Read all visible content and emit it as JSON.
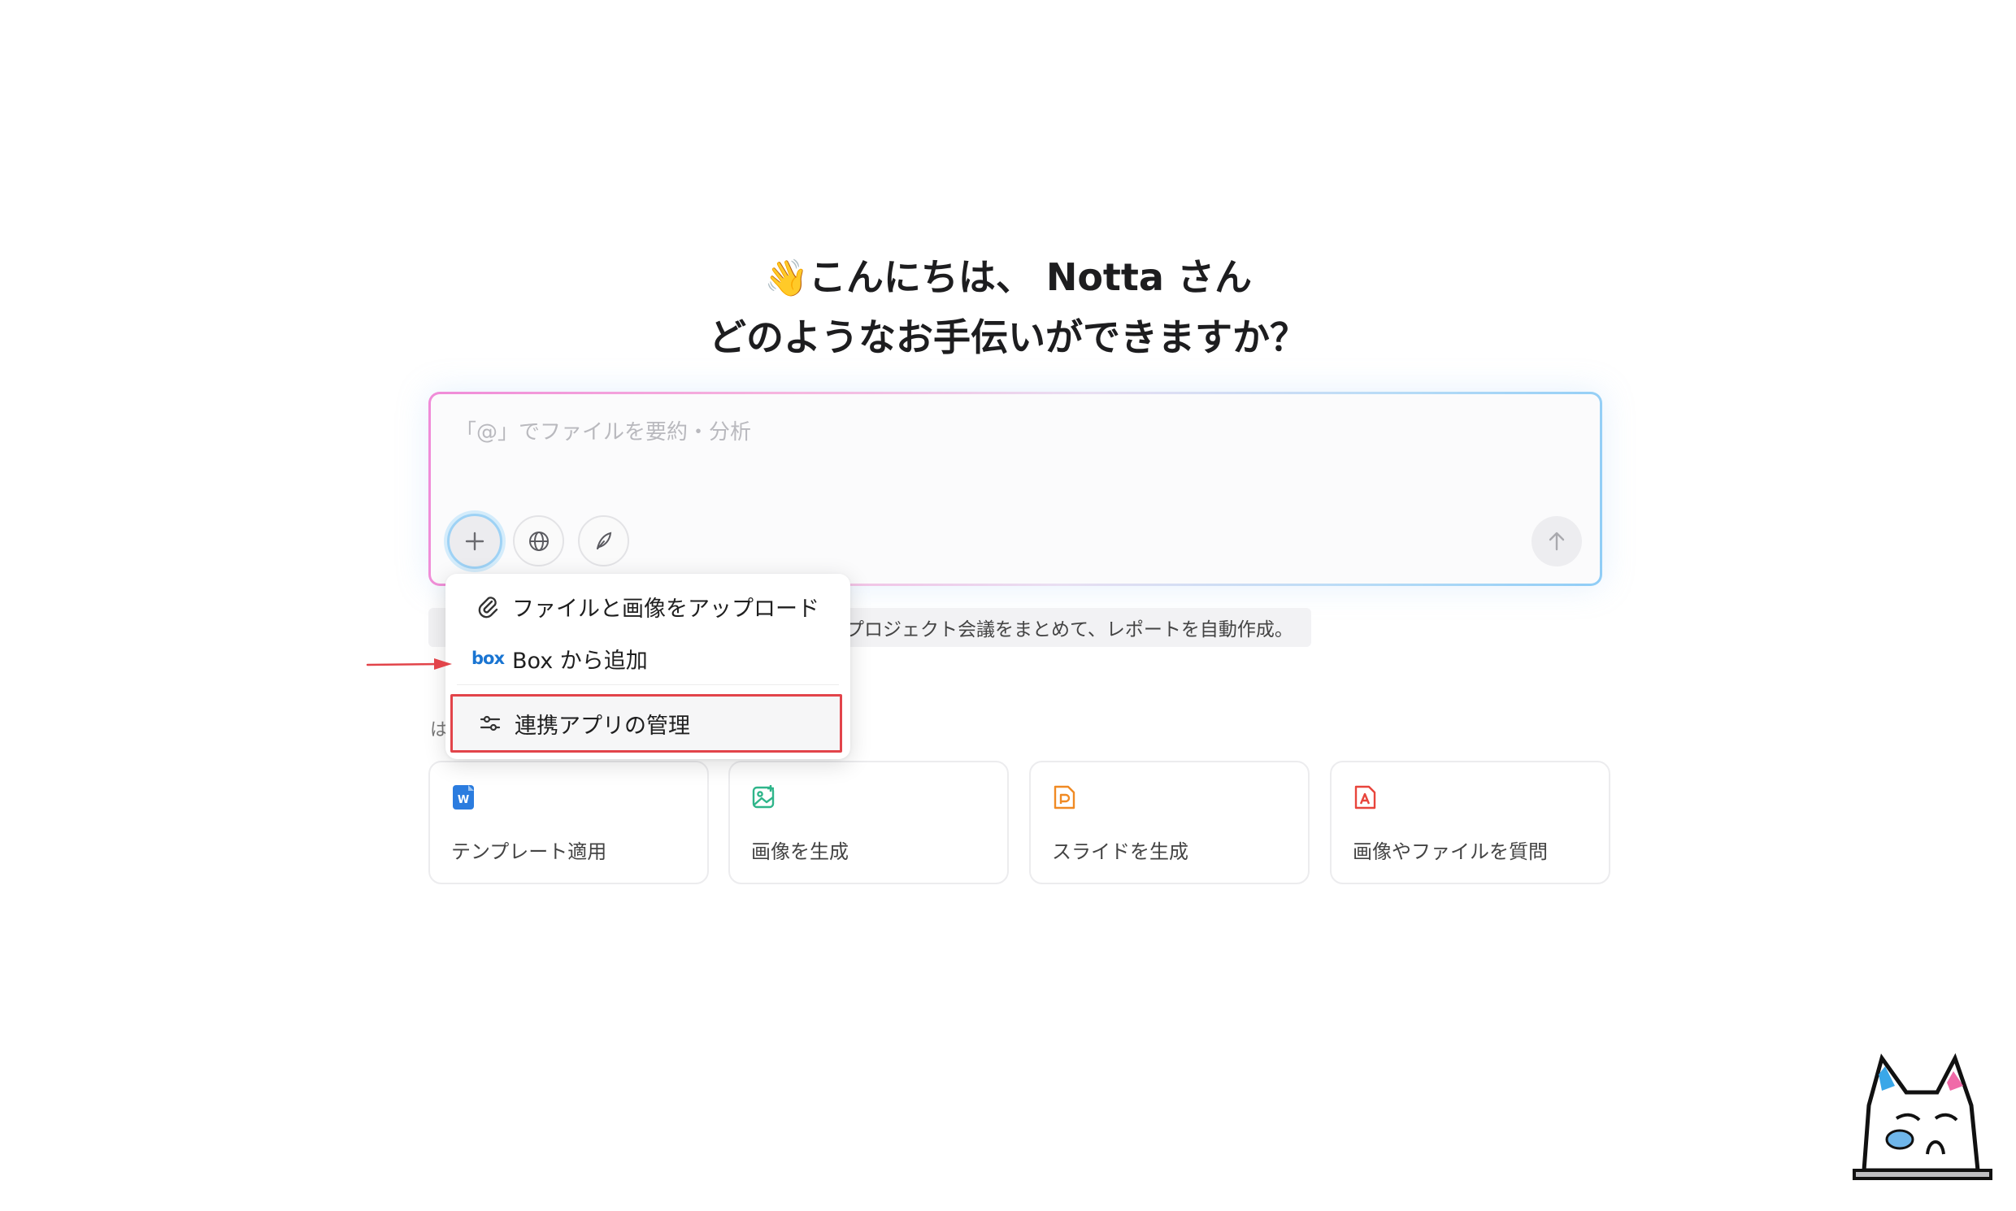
{
  "greeting": {
    "wave_emoji": "👋",
    "line1": "こんにちは、 Notta さん",
    "line2": "どのようなお手伝いができますか？"
  },
  "composer": {
    "placeholder": "「@」でファイルを要約・分析"
  },
  "suggestion_chip": {
    "text": "プロジェクト会議をまとめて、レポートを自動作成。"
  },
  "side_char": "は",
  "menu": {
    "items": [
      {
        "label": "ファイルと画像をアップロード",
        "icon": "paperclip-icon"
      },
      {
        "label": "Box から追加",
        "icon": "box-logo-icon",
        "logo_text": "box"
      },
      {
        "label": "連携アプリの管理",
        "icon": "sliders-icon"
      }
    ]
  },
  "cards": [
    {
      "label": "テンプレート適用",
      "icon": "word-doc-icon",
      "color": "#2b7cdf"
    },
    {
      "label": "画像を生成",
      "icon": "image-add-icon",
      "color": "#2fb58a"
    },
    {
      "label": "スライドを生成",
      "icon": "slides-doc-icon",
      "color": "#f08a24"
    },
    {
      "label": "画像やファイルを質問",
      "icon": "pdf-doc-icon",
      "color": "#e8453c"
    }
  ],
  "colors": {
    "highlight_border": "#e2444a",
    "arrow": "#e2444a",
    "plus_ring": "#9ed2f5"
  }
}
